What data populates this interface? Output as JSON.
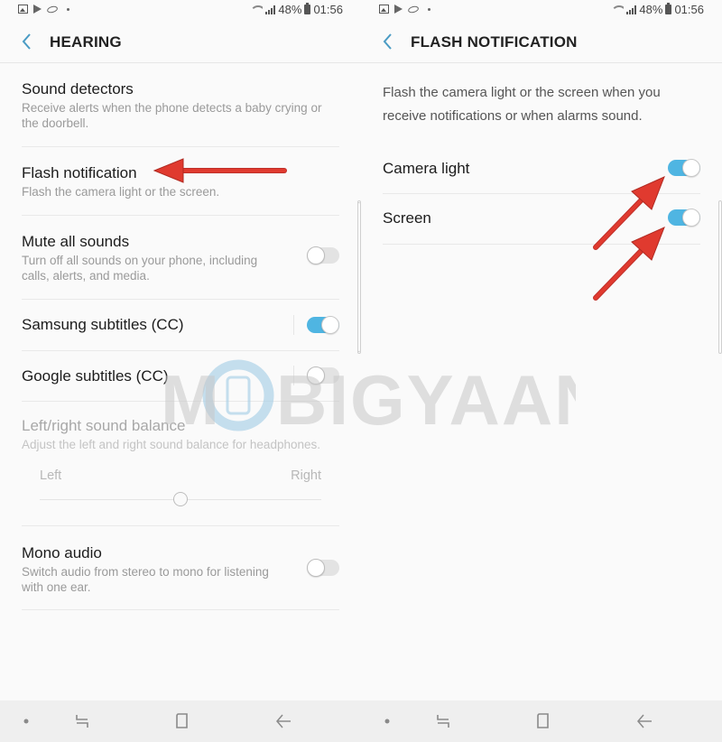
{
  "status_bar": {
    "battery": "48%",
    "time": "01:56",
    "left_icons": [
      "gallery-icon",
      "play-store-icon",
      "sync-loop-icon",
      "more-dot-icon"
    ],
    "right_icons": [
      "wifi-icon",
      "signal-icon",
      "battery-icon"
    ]
  },
  "left_screen": {
    "title": "HEARING",
    "items": [
      {
        "title": "Sound detectors",
        "subtitle": "Receive alerts when the phone detects a baby crying or the doorbell."
      },
      {
        "title": "Flash notification",
        "subtitle": "Flash the camera light or the screen."
      },
      {
        "title": "Mute all sounds",
        "subtitle": "Turn off all sounds on your phone, including calls, alerts, and media.",
        "toggle": false
      },
      {
        "title": "Samsung subtitles (CC)",
        "toggle": true
      },
      {
        "title": "Google subtitles (CC)",
        "toggle": false
      },
      {
        "title": "Left/right sound balance",
        "subtitle": "Adjust the left and right sound balance for headphones.",
        "disabled": true,
        "slider": {
          "left_label": "Left",
          "right_label": "Right",
          "value": 0.5
        }
      },
      {
        "title": "Mono audio",
        "subtitle": "Switch audio from stereo to mono for listening with one ear.",
        "toggle": false
      }
    ]
  },
  "right_screen": {
    "title": "FLASH NOTIFICATION",
    "description": "Flash the camera light or the screen when you receive notifications or when alarms sound.",
    "items": [
      {
        "title": "Camera light",
        "toggle": true
      },
      {
        "title": "Screen",
        "toggle": true
      }
    ]
  },
  "nav_bar": {
    "buttons": [
      "dot-icon",
      "recents-icon",
      "home-icon",
      "back-icon"
    ]
  },
  "watermark": {
    "text": "MOBIGYAAN"
  },
  "colors": {
    "accent": "#4fb5e2",
    "back_arrow": "#4a9bc4",
    "annotation_arrow": "#e03a2f"
  }
}
